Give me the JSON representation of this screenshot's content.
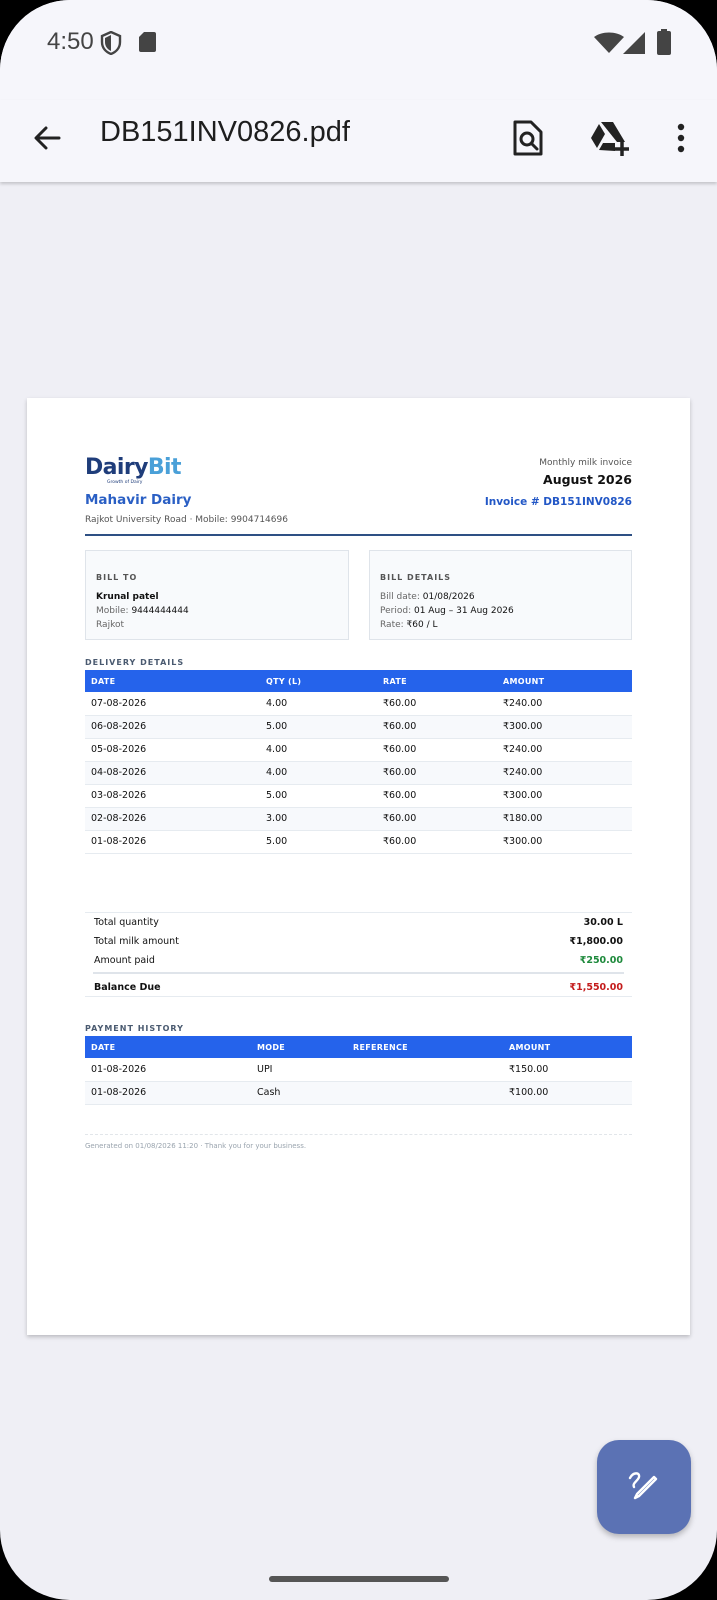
{
  "status": {
    "time": "4:50"
  },
  "appbar": {
    "title": "DB151INV0826.pdf"
  },
  "invoice": {
    "logo": {
      "word1": "Dairy",
      "word2": "Bit",
      "tagline": "Growth of Dairy"
    },
    "company_name": "Mahavir Dairy",
    "company_address": "Rajkot University Road · Mobile: 9904714696",
    "type_label": "Monthly milk invoice",
    "month": "August 2026",
    "invoice_number": "Invoice # DB151INV0826",
    "bill_to": {
      "heading": "BILL TO",
      "name": "Krunal patel",
      "mobile_label": "Mobile:",
      "mobile": "9444444444",
      "city": "Rajkot"
    },
    "bill_details": {
      "heading": "BILL DETAILS",
      "date_label": "Bill date:",
      "date": "01/08/2026",
      "period_label": "Period:",
      "period": "01 Aug – 31 Aug 2026",
      "rate_label": "Rate:",
      "rate": "₹60 / L"
    },
    "delivery": {
      "heading": "DELIVERY DETAILS",
      "columns": [
        "DATE",
        "QTY (L)",
        "RATE",
        "AMOUNT"
      ],
      "rows": [
        [
          "07-08-2026",
          "4.00",
          "₹60.00",
          "₹240.00"
        ],
        [
          "06-08-2026",
          "5.00",
          "₹60.00",
          "₹300.00"
        ],
        [
          "05-08-2026",
          "4.00",
          "₹60.00",
          "₹240.00"
        ],
        [
          "04-08-2026",
          "4.00",
          "₹60.00",
          "₹240.00"
        ],
        [
          "03-08-2026",
          "5.00",
          "₹60.00",
          "₹300.00"
        ],
        [
          "02-08-2026",
          "3.00",
          "₹60.00",
          "₹180.00"
        ],
        [
          "01-08-2026",
          "5.00",
          "₹60.00",
          "₹300.00"
        ]
      ]
    },
    "totals": {
      "qty_label": "Total quantity",
      "qty": "30.00 L",
      "amount_label": "Total milk amount",
      "amount": "₹1,800.00",
      "paid_label": "Amount paid",
      "paid": "₹250.00",
      "balance_label": "Balance Due",
      "balance": "₹1,550.00"
    },
    "payments": {
      "heading": "PAYMENT HISTORY",
      "columns": [
        "DATE",
        "MODE",
        "REFERENCE",
        "AMOUNT"
      ],
      "rows": [
        [
          "01-08-2026",
          "UPI",
          "",
          "₹150.00"
        ],
        [
          "01-08-2026",
          "Cash",
          "",
          "₹100.00"
        ]
      ]
    },
    "footer": "Generated on 01/08/2026 11:20 · Thank you for your business."
  },
  "colors": {
    "accent": "#2563eb",
    "paid": "#1e8a3c",
    "due": "#c41c1c",
    "fab": "#5b72b4"
  },
  "icons": [
    "back-arrow-icon",
    "search-document-icon",
    "drive-add-icon",
    "more-vert-icon",
    "edit-pen-icon",
    "shield-icon",
    "sd-card-icon",
    "wifi-icon",
    "signal-icon",
    "battery-icon"
  ]
}
